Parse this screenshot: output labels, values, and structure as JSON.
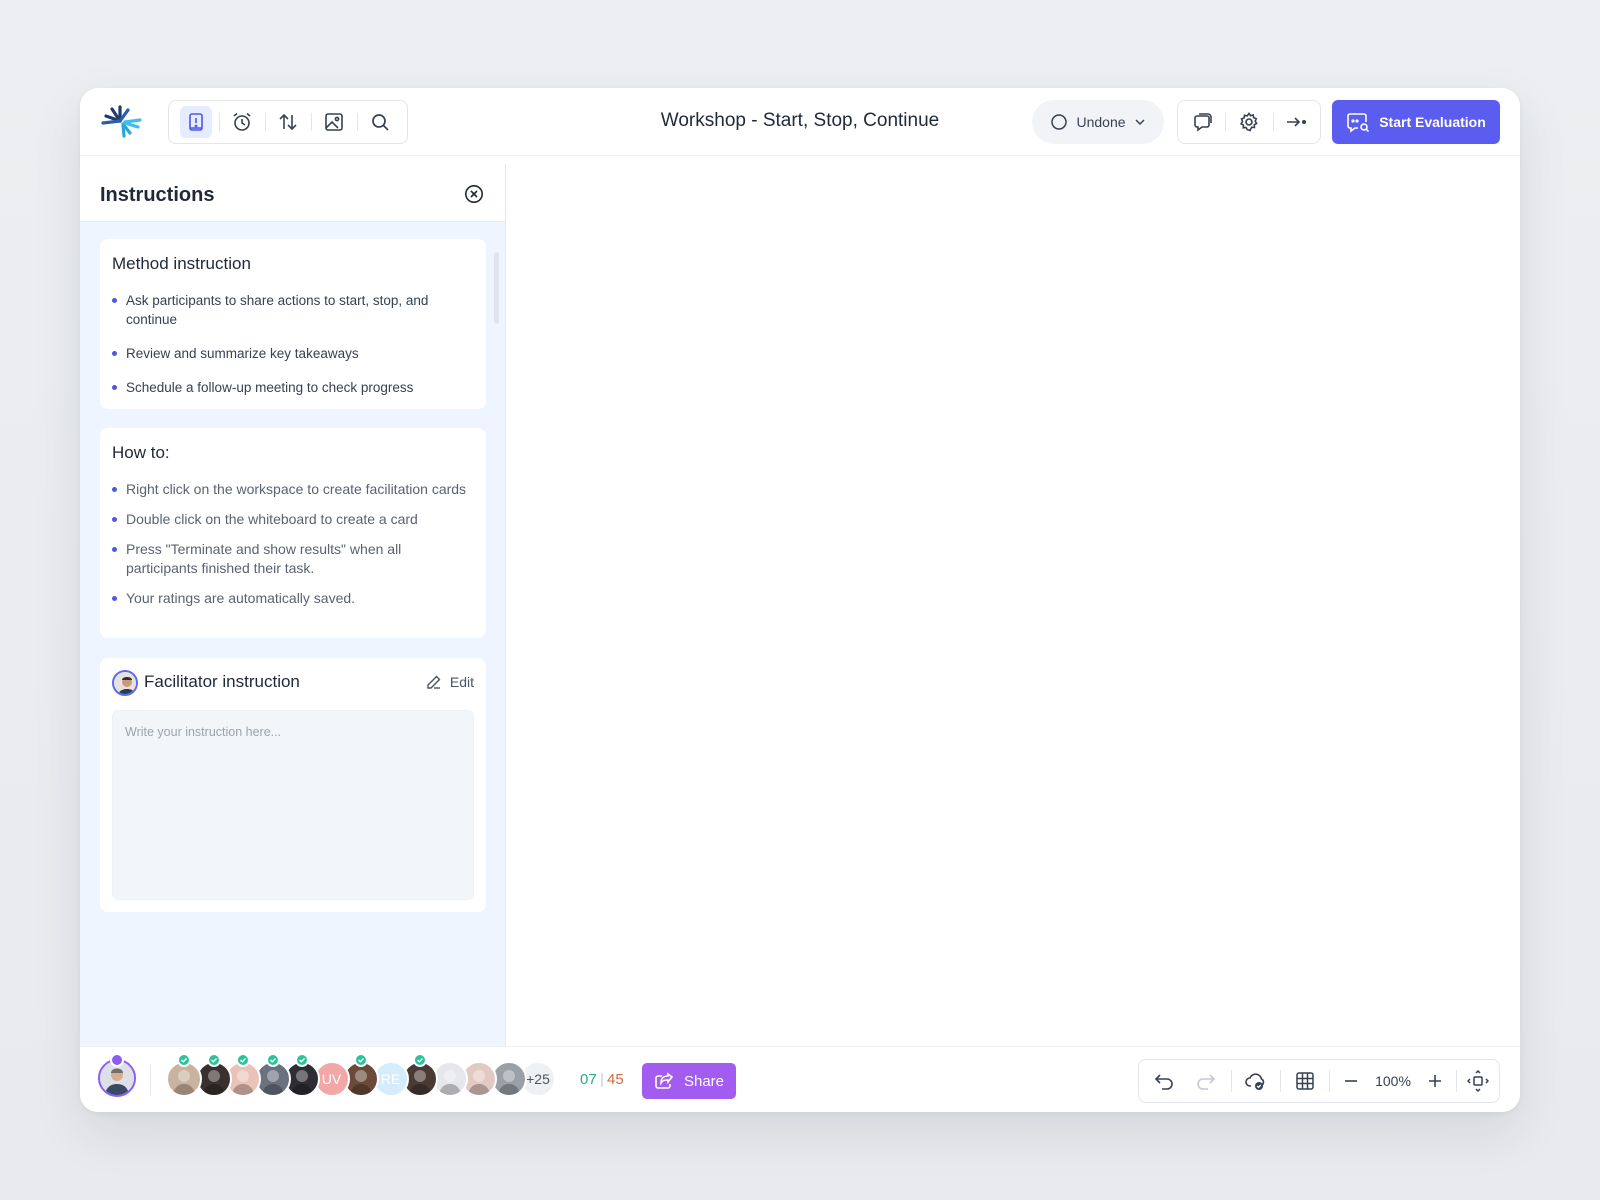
{
  "header": {
    "title": "Workshop - Start, Stop, Continue",
    "status": "Undone",
    "start_evaluation": "Start Evaluation",
    "toolbar_icons": [
      "instructions-icon",
      "alarm-icon",
      "sort-icon",
      "image-icon",
      "search-icon"
    ],
    "right_icons": [
      "comments-icon",
      "gear-icon",
      "exit-icon"
    ]
  },
  "panel": {
    "title": "Instructions",
    "method": {
      "heading": "Method instruction",
      "items": [
        "Ask participants to share actions to start, stop, and continue",
        "Review and summarize key takeaways",
        "Schedule a follow-up meeting to check progress"
      ]
    },
    "howto": {
      "heading": "How to:",
      "items": [
        "Right click on the workspace to create facilitation cards",
        "Double click on the whiteboard to create a card",
        "Press \"Terminate and show results\" when all participants finished their task.",
        "Your ratings are automatically saved."
      ]
    },
    "facilitator": {
      "heading": "Facilitator instruction",
      "edit": "Edit",
      "placeholder": "Write your instruction here..."
    }
  },
  "footer": {
    "participants": [
      {
        "initials": "",
        "done": true,
        "color": "#c9b3a0"
      },
      {
        "initials": "",
        "done": true,
        "color": "#3b3030"
      },
      {
        "initials": "",
        "done": true,
        "color": "#e9c3b8"
      },
      {
        "initials": "",
        "done": true,
        "color": "#6a7280"
      },
      {
        "initials": "",
        "done": true,
        "color": "#2d2d33"
      },
      {
        "initials": "UV",
        "done": false,
        "color": "#f2a7a7"
      },
      {
        "initials": "",
        "done": true,
        "color": "#6b4a3a"
      },
      {
        "initials": "RE",
        "done": false,
        "color": "#d4ecfb"
      },
      {
        "initials": "",
        "done": true,
        "color": "#4a3a35"
      },
      {
        "initials": "",
        "done": false,
        "color": "#e5e7eb"
      },
      {
        "initials": "",
        "done": false,
        "color": "#e3c9c2"
      },
      {
        "initials": "",
        "done": false,
        "color": "#9aa0a8"
      }
    ],
    "more": "+25",
    "done_count": "07",
    "total_count": "45",
    "share": "Share",
    "zoom": "100%"
  },
  "colors": {
    "primary": "#5b5cf0",
    "share": "#a25cf0",
    "done": "#22b07d",
    "total": "#d06a3f",
    "panel_bg": "#eff5ff"
  }
}
